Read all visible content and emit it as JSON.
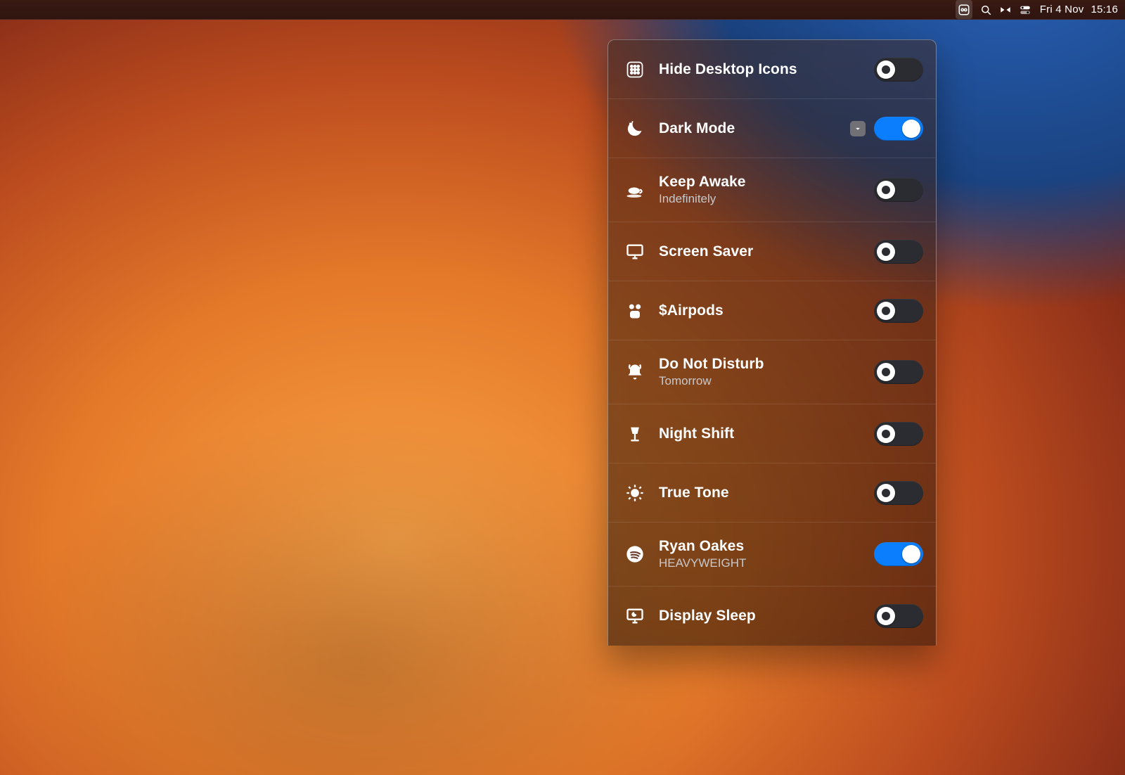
{
  "menubar": {
    "date": "Fri 4 Nov",
    "time": "15:16",
    "status_icons": [
      "app-switch",
      "search",
      "bowtie",
      "control-center"
    ]
  },
  "panel": {
    "items": [
      {
        "id": "hide-desktop-icons",
        "icon": "grid-icon",
        "title": "Hide Desktop Icons",
        "subtitle": "",
        "chevron": false,
        "on": false
      },
      {
        "id": "dark-mode",
        "icon": "moon-icon",
        "title": "Dark Mode",
        "subtitle": "",
        "chevron": true,
        "on": true
      },
      {
        "id": "keep-awake",
        "icon": "coffee-icon",
        "title": "Keep Awake",
        "subtitle": "Indefinitely",
        "chevron": false,
        "on": false
      },
      {
        "id": "screen-saver",
        "icon": "monitor-icon",
        "title": "Screen Saver",
        "subtitle": "",
        "chevron": false,
        "on": false
      },
      {
        "id": "airpods",
        "icon": "airpods-icon",
        "title": "$Airpods",
        "subtitle": "",
        "chevron": false,
        "on": false
      },
      {
        "id": "do-not-disturb",
        "icon": "bell-icon",
        "title": "Do Not Disturb",
        "subtitle": "Tomorrow",
        "chevron": false,
        "on": false
      },
      {
        "id": "night-shift",
        "icon": "lamp-icon",
        "title": "Night Shift",
        "subtitle": "",
        "chevron": false,
        "on": false
      },
      {
        "id": "true-tone",
        "icon": "sun-icon",
        "title": "True Tone",
        "subtitle": "",
        "chevron": false,
        "on": false
      },
      {
        "id": "now-playing",
        "icon": "spotify-icon",
        "title": "Ryan Oakes",
        "subtitle": "HEAVYWEIGHT",
        "chevron": false,
        "on": true
      },
      {
        "id": "display-sleep",
        "icon": "display-sleep-icon",
        "title": "Display Sleep",
        "subtitle": "",
        "chevron": false,
        "on": false
      }
    ]
  },
  "colors": {
    "accent": "#0a7efc"
  }
}
